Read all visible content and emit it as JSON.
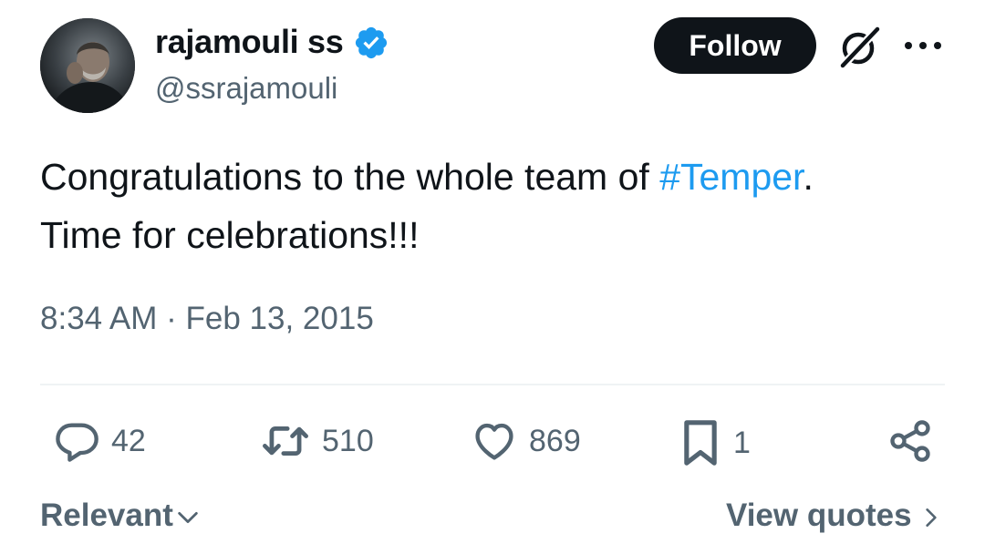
{
  "author": {
    "display_name": "rajamouli ss",
    "handle": "@ssrajamouli",
    "verified": true,
    "avatar": "profile-photo"
  },
  "header_actions": {
    "follow_label": "Follow",
    "grok_icon": "grok-icon",
    "more_icon": "more-icon"
  },
  "tweet": {
    "text_before": "Congratulations to the whole team of ",
    "hashtag": "#Temper",
    "text_after": ".",
    "line2": "Time for celebrations!!!",
    "timestamp": "8:34 AM · Feb 13, 2015"
  },
  "engagement": {
    "replies": "42",
    "reposts": "510",
    "likes": "869",
    "bookmarks": "1",
    "share_icon": "share-icon"
  },
  "footer": {
    "sort_label": "Relevant",
    "view_quotes_label": "View quotes"
  },
  "colors": {
    "text": "#0f1419",
    "secondary": "#536471",
    "accent": "#1d9bf0",
    "button": "#0f1419"
  }
}
